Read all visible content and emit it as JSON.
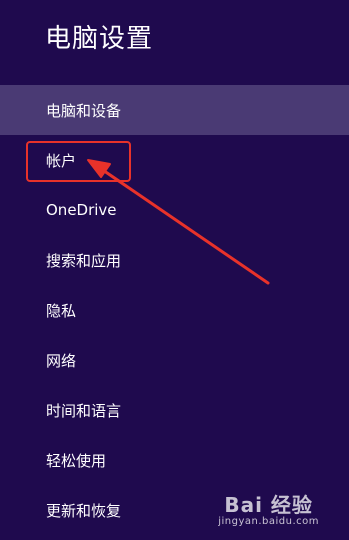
{
  "window": {
    "title": "电脑设置"
  },
  "menu": {
    "items": [
      {
        "label": "电脑和设备",
        "selected": true
      },
      {
        "label": "帐户",
        "selected": false
      },
      {
        "label": "OneDrive",
        "selected": false
      },
      {
        "label": "搜索和应用",
        "selected": false
      },
      {
        "label": "隐私",
        "selected": false
      },
      {
        "label": "网络",
        "selected": false
      },
      {
        "label": "时间和语言",
        "selected": false
      },
      {
        "label": "轻松使用",
        "selected": false
      },
      {
        "label": "更新和恢复",
        "selected": false
      }
    ]
  },
  "watermark": {
    "logo_text": "Bai 经验",
    "url": "jingyan.baidu.com"
  },
  "colors": {
    "background": "#1f0a4e",
    "selected": "#4a3a74",
    "annotation": "#e8322a"
  }
}
